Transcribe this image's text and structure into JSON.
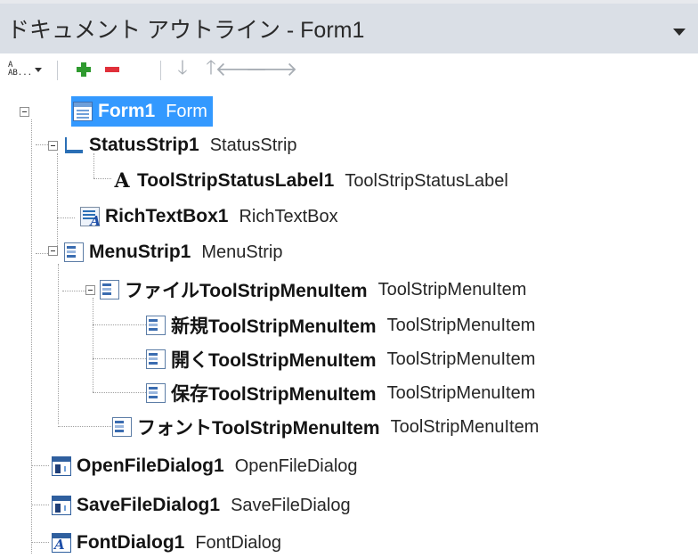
{
  "panel": {
    "title": "ドキュメント アウトライン - Form1",
    "dropdown_icon": "chevron-down-icon"
  },
  "toolbar": {
    "rename_icon_text": "A\nAB...",
    "buttons": [
      {
        "name": "add",
        "icon": "plus-icon",
        "color": "#2f9a2f"
      },
      {
        "name": "remove",
        "icon": "minus-icon",
        "color": "#e0303a"
      },
      {
        "name": "move-down",
        "icon": "arrow-down-icon",
        "glyph": "🡓"
      },
      {
        "name": "move-up",
        "icon": "arrow-up-icon",
        "glyph": "🡑"
      },
      {
        "name": "move-left",
        "icon": "arrow-left-icon",
        "glyph": "🡐"
      },
      {
        "name": "move-right",
        "icon": "arrow-right-icon",
        "glyph": "🡒"
      }
    ]
  },
  "tree": {
    "nodes": [
      {
        "name": "Form1",
        "type": "Form",
        "icon": "form-icon",
        "selected": true
      },
      {
        "name": "StatusStrip1",
        "type": "StatusStrip",
        "icon": "statusstrip-icon"
      },
      {
        "name": "ToolStripStatusLabel1",
        "type": "ToolStripStatusLabel",
        "icon": "label-icon"
      },
      {
        "name": "RichTextBox1",
        "type": "RichTextBox",
        "icon": "richtextbox-icon"
      },
      {
        "name": "MenuStrip1",
        "type": "MenuStrip",
        "icon": "menustrip-icon"
      },
      {
        "name": "ファイルToolStripMenuItem",
        "type": "ToolStripMenuItem",
        "icon": "menuitem-icon"
      },
      {
        "name": "新規ToolStripMenuItem",
        "type": "ToolStripMenuItem",
        "icon": "menuitem-icon"
      },
      {
        "name": "開くToolStripMenuItem",
        "type": "ToolStripMenuItem",
        "icon": "menuitem-icon"
      },
      {
        "name": "保存ToolStripMenuItem",
        "type": "ToolStripMenuItem",
        "icon": "menuitem-icon"
      },
      {
        "name": "フォントToolStripMenuItem",
        "type": "ToolStripMenuItem",
        "icon": "menuitem-icon"
      },
      {
        "name": "OpenFileDialog1",
        "type": "OpenFileDialog",
        "icon": "dialog-icon"
      },
      {
        "name": "SaveFileDialog1",
        "type": "SaveFileDialog",
        "icon": "dialog-icon"
      },
      {
        "name": "FontDialog1",
        "type": "FontDialog",
        "icon": "fontdialog-icon"
      }
    ]
  },
  "colors": {
    "header_bg": "#dadfe6",
    "selection": "#3399ff"
  }
}
